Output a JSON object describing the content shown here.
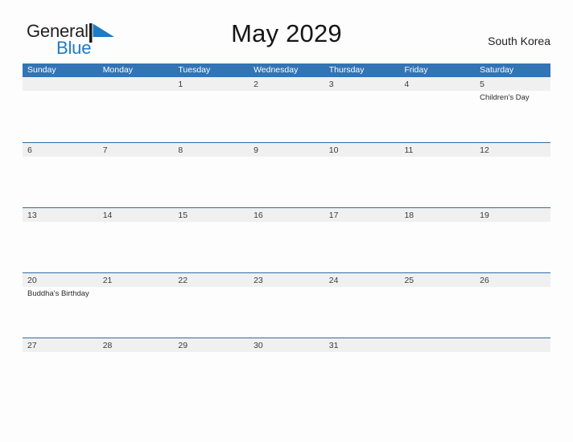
{
  "brand": {
    "name_part1": "General",
    "name_part2": "Blue",
    "flag_icon": "blue-triangle-flag-icon"
  },
  "header": {
    "title": "May 2029",
    "country": "South Korea"
  },
  "colors": {
    "header_blue": "#3274b4",
    "row_divider_blue": "#2e6da4",
    "day_band_gray": "#f0f0f0",
    "brand_blue": "#1e7bc4",
    "page_background": "#fdfdfd"
  },
  "calendar": {
    "weekdays": [
      "Sunday",
      "Monday",
      "Tuesday",
      "Wednesday",
      "Thursday",
      "Friday",
      "Saturday"
    ],
    "weeks": [
      [
        {
          "day": "",
          "events": []
        },
        {
          "day": "",
          "events": []
        },
        {
          "day": "1",
          "events": []
        },
        {
          "day": "2",
          "events": []
        },
        {
          "day": "3",
          "events": []
        },
        {
          "day": "4",
          "events": []
        },
        {
          "day": "5",
          "events": [
            "Children's Day"
          ]
        }
      ],
      [
        {
          "day": "6",
          "events": []
        },
        {
          "day": "7",
          "events": []
        },
        {
          "day": "8",
          "events": []
        },
        {
          "day": "9",
          "events": []
        },
        {
          "day": "10",
          "events": []
        },
        {
          "day": "11",
          "events": []
        },
        {
          "day": "12",
          "events": []
        }
      ],
      [
        {
          "day": "13",
          "events": []
        },
        {
          "day": "14",
          "events": []
        },
        {
          "day": "15",
          "events": []
        },
        {
          "day": "16",
          "events": []
        },
        {
          "day": "17",
          "events": []
        },
        {
          "day": "18",
          "events": []
        },
        {
          "day": "19",
          "events": []
        }
      ],
      [
        {
          "day": "20",
          "events": [
            "Buddha's Birthday"
          ]
        },
        {
          "day": "21",
          "events": []
        },
        {
          "day": "22",
          "events": []
        },
        {
          "day": "23",
          "events": []
        },
        {
          "day": "24",
          "events": []
        },
        {
          "day": "25",
          "events": []
        },
        {
          "day": "26",
          "events": []
        }
      ],
      [
        {
          "day": "27",
          "events": []
        },
        {
          "day": "28",
          "events": []
        },
        {
          "day": "29",
          "events": []
        },
        {
          "day": "30",
          "events": []
        },
        {
          "day": "31",
          "events": []
        },
        {
          "day": "",
          "events": []
        },
        {
          "day": "",
          "events": []
        }
      ]
    ]
  }
}
